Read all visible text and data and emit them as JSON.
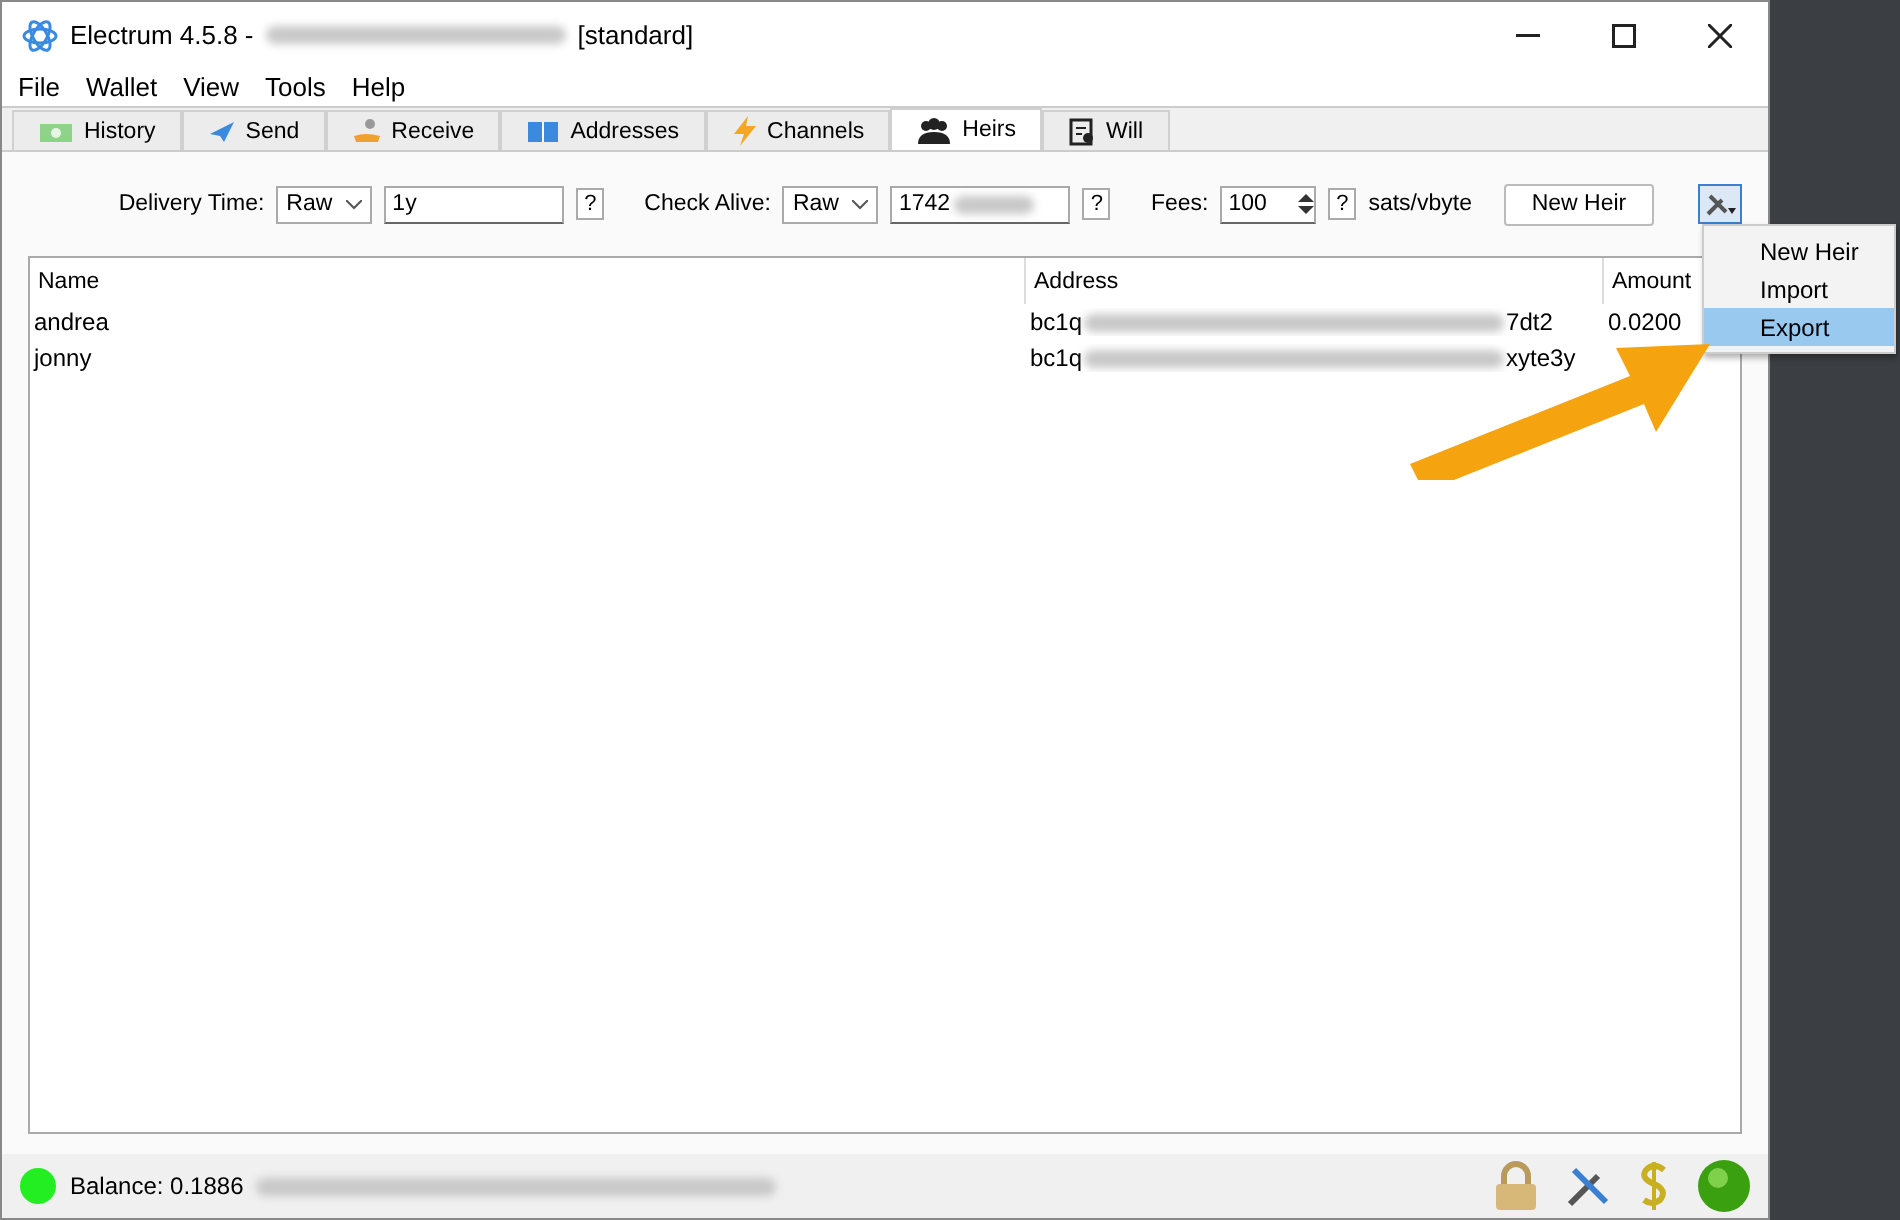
{
  "window": {
    "title": "Electrum 4.5.8  -",
    "title_suffix": "[standard]"
  },
  "menu": [
    "File",
    "Wallet",
    "View",
    "Tools",
    "Help"
  ],
  "tabs": [
    {
      "label": "History",
      "selected": false
    },
    {
      "label": "Send",
      "selected": false
    },
    {
      "label": "Receive",
      "selected": false
    },
    {
      "label": "Addresses",
      "selected": false
    },
    {
      "label": "Channels",
      "selected": false
    },
    {
      "label": "Heirs",
      "selected": true
    },
    {
      "label": "Will",
      "selected": false
    }
  ],
  "toolbar": {
    "delivery_label": "Delivery Time:",
    "delivery_unit": "Raw",
    "delivery_value": "1y",
    "check_label": "Check Alive:",
    "check_unit": "Raw",
    "check_value": "1742",
    "fees_label": "Fees:",
    "fees_value": "100",
    "fees_unit": "sats/vbyte",
    "help": "?",
    "new_heir": "New Heir"
  },
  "table": {
    "columns": [
      "Name",
      "Address",
      "Amount"
    ],
    "rows": [
      {
        "name": "andrea",
        "address_start": "bc1q",
        "address_end": "7dt2",
        "amount": "0.0200"
      },
      {
        "name": "jonny",
        "address_start": "bc1q",
        "address_end": "xyte3y"
      }
    ]
  },
  "popup_menu": [
    {
      "label": "New Heir",
      "selected": false
    },
    {
      "label": "Import",
      "selected": false
    },
    {
      "label": "Export",
      "selected": true
    }
  ],
  "status_bar": {
    "balance": "Balance: 0.1886",
    "connected": true
  }
}
